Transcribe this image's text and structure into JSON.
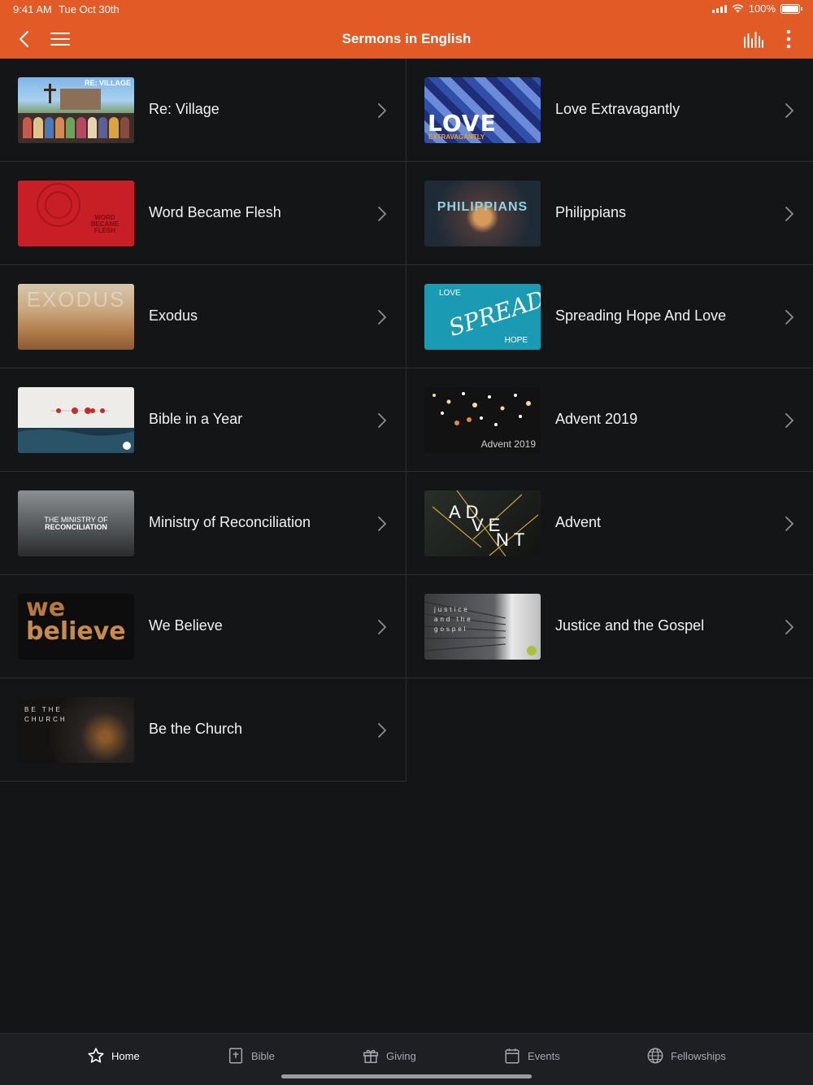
{
  "status_bar": {
    "time": "9:41 AM",
    "date": "Tue Oct 30th",
    "battery": "100%"
  },
  "header": {
    "title": "Sermons in English"
  },
  "series": [
    {
      "title": "Re: Village",
      "thumb_text": "RE: VILLAGE"
    },
    {
      "title": "Love Extravagantly",
      "thumb_text": "LOVE",
      "thumb_sub": "EXTRAVAGANTLY"
    },
    {
      "title": "Word Became Flesh",
      "thumb_text": "WORD BECAME FLESH"
    },
    {
      "title": "Philippians",
      "thumb_text": "PHILIPPIANS"
    },
    {
      "title": "Exodus",
      "thumb_text": "EXODUS"
    },
    {
      "title": "Spreading Hope And Love",
      "thumb_text": "SPREAD",
      "thumb_sub": "LOVE",
      "thumb_sub2": "HOPE"
    },
    {
      "title": "Bible in a Year",
      "thumb_text": ""
    },
    {
      "title": "Advent 2019",
      "thumb_text": "Advent 2019"
    },
    {
      "title": "Ministry of Reconciliation",
      "thumb_text": "THE MINISTRY OF",
      "thumb_sub": "RECONCILIATION"
    },
    {
      "title": "Advent",
      "thumb_text": "AD",
      "thumb_sub": "VE",
      "thumb_sub2": "NT"
    },
    {
      "title": "We Believe",
      "thumb_text": "we",
      "thumb_sub": "believe"
    },
    {
      "title": "Justice and the Gospel",
      "thumb_text": "justice and the gospel"
    },
    {
      "title": "Be the Church",
      "thumb_text": "BE THE CHURCH"
    }
  ],
  "tabs": [
    {
      "label": "Home",
      "icon": "star-icon"
    },
    {
      "label": "Bible",
      "icon": "bible-icon"
    },
    {
      "label": "Giving",
      "icon": "gift-icon"
    },
    {
      "label": "Events",
      "icon": "calendar-icon"
    },
    {
      "label": "Fellowships",
      "icon": "globe-icon"
    }
  ],
  "colors": {
    "accent": "#e25a26",
    "background": "#141517",
    "tabbar": "#1e1f22"
  }
}
